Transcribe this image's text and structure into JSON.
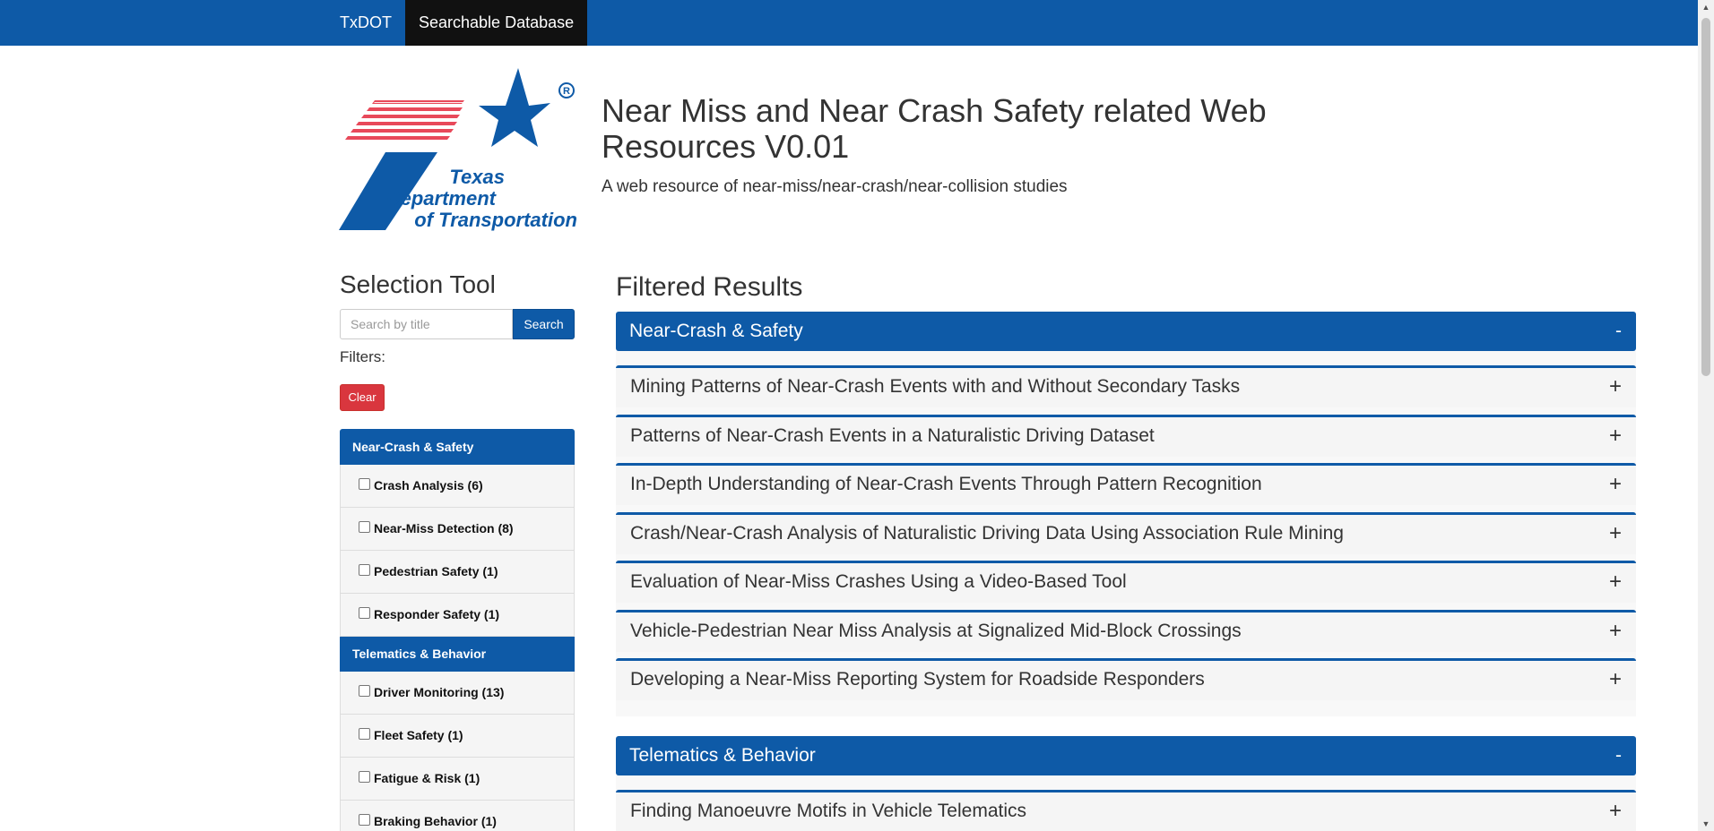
{
  "navbar": {
    "brand": "TxDOT",
    "active_tab": "Searchable Database"
  },
  "logo": {
    "line1": "Texas",
    "line2": "Department",
    "line3": "of Transportation",
    "registered": "®"
  },
  "header": {
    "title": "Near Miss and Near Crash Safety related Web Resources V0.01",
    "subtitle": "A web resource of near-miss/near-crash/near-collision studies"
  },
  "sidebar": {
    "heading": "Selection Tool",
    "search": {
      "placeholder": "Search by title",
      "value": "",
      "button_label": "Search"
    },
    "filters_label": "Filters:",
    "clear_label": "Clear",
    "groups": [
      {
        "title": "Near-Crash & Safety",
        "items": [
          {
            "label": "Crash Analysis (6)",
            "checked": false
          },
          {
            "label": "Near-Miss Detection (8)",
            "checked": false
          },
          {
            "label": "Pedestrian Safety (1)",
            "checked": false
          },
          {
            "label": "Responder Safety (1)",
            "checked": false
          }
        ]
      },
      {
        "title": "Telematics & Behavior",
        "items": [
          {
            "label": "Driver Monitoring (13)",
            "checked": false
          },
          {
            "label": "Fleet Safety (1)",
            "checked": false
          },
          {
            "label": "Fatigue & Risk (1)",
            "checked": false
          },
          {
            "label": "Braking Behavior (1)",
            "checked": false
          }
        ]
      }
    ]
  },
  "results": {
    "heading": "Filtered Results",
    "categories": [
      {
        "title": "Near-Crash & Safety",
        "toggle": "-",
        "items": [
          "Mining Patterns of Near-Crash Events with and Without Secondary Tasks",
          "Patterns of Near-Crash Events in a Naturalistic Driving Dataset",
          "In-Depth Understanding of Near-Crash Events Through Pattern Recognition",
          "Crash/Near-Crash Analysis of Naturalistic Driving Data Using Association Rule Mining",
          "Evaluation of Near-Miss Crashes Using a Video-Based Tool",
          "Vehicle-Pedestrian Near Miss Analysis at Signalized Mid-Block Crossings",
          "Developing a Near-Miss Reporting System for Roadside Responders"
        ]
      },
      {
        "title": "Telematics & Behavior",
        "toggle": "-",
        "items": [
          "Finding Manoeuvre Motifs in Vehicle Telematics"
        ]
      }
    ],
    "expand_symbol": "+"
  },
  "colors": {
    "brand_blue": "#0e5aa7",
    "nav_active": "#111111",
    "clear_red": "#d9363e",
    "logo_stripes": "#e8495a"
  }
}
